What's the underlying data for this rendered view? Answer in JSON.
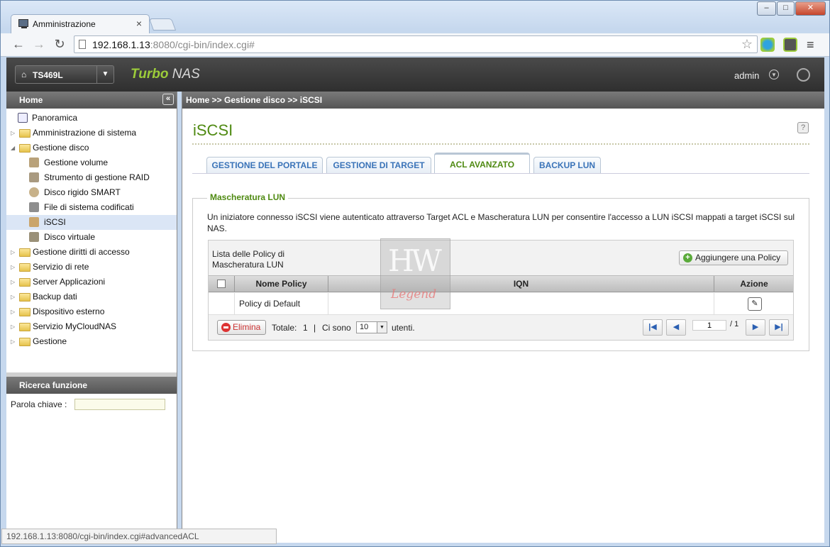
{
  "browser": {
    "tab_title": "Amministrazione",
    "tab_close": "×",
    "url_host": "192.168.1.13",
    "url_rest": ":8080/cgi-bin/index.cgi#",
    "status_url": "192.168.1.13:8080/cgi-bin/index.cgi#advancedACL"
  },
  "header": {
    "model": "TS469L",
    "brand_turbo": "Turbo",
    "brand_nas": "NAS",
    "user": "admin"
  },
  "sidebar": {
    "title": "Home",
    "items": [
      {
        "label": "Panoramica"
      },
      {
        "label": "Amministrazione di sistema"
      },
      {
        "label": "Gestione disco"
      },
      {
        "label": "Gestione volume"
      },
      {
        "label": "Strumento di gestione RAID"
      },
      {
        "label": "Disco rigido SMART"
      },
      {
        "label": "File di sistema codificati"
      },
      {
        "label": "iSCSI"
      },
      {
        "label": "Disco virtuale"
      },
      {
        "label": "Gestione diritti di accesso"
      },
      {
        "label": "Servizio di rete"
      },
      {
        "label": "Server Applicazioni"
      },
      {
        "label": "Backup dati"
      },
      {
        "label": "Dispositivo esterno"
      },
      {
        "label": "Servizio MyCloudNAS"
      },
      {
        "label": "Gestione"
      }
    ],
    "search_title": "Ricerca funzione",
    "keyword_label": "Parola chiave :"
  },
  "main": {
    "breadcrumb": "Home >> Gestione disco >> iSCSI",
    "page_title": "iSCSI",
    "tabs": [
      {
        "label": "GESTIONE DEL PORTALE"
      },
      {
        "label": "GESTIONE DI TARGET"
      },
      {
        "label": "ACL AVANZATO"
      },
      {
        "label": "BACKUP LUN"
      }
    ],
    "active_tab": "ACL AVANZATO",
    "section_title": "Mascheratura LUN",
    "description": "Un iniziatore connesso iSCSI viene autenticato attraverso Target ACL e Mascheratura LUN per consentire l'accesso a LUN iSCSI mappati a target iSCSI sul NAS.",
    "grid": {
      "title_line1": "Lista delle Policy di",
      "title_line2": "Mascheratura LUN",
      "add_button": "Aggiungere una Policy",
      "columns": [
        "Nome Policy",
        "IQN",
        "Azione"
      ],
      "rows": [
        {
          "name": "Policy di Default",
          "iqn": ""
        }
      ],
      "delete_button": "Elimina",
      "total_label": "Totale:",
      "total_value": "1",
      "sep": "|",
      "per_page_label": "Ci sono",
      "per_page_value": "10",
      "per_page_suffix": "utenti.",
      "page_current": "1",
      "page_total": "/ 1"
    }
  },
  "watermark": {
    "text1": "HW",
    "text2": "Legend"
  },
  "colors": {
    "accent_green": "#4f8a12",
    "tab_blue": "#3a73b8"
  }
}
